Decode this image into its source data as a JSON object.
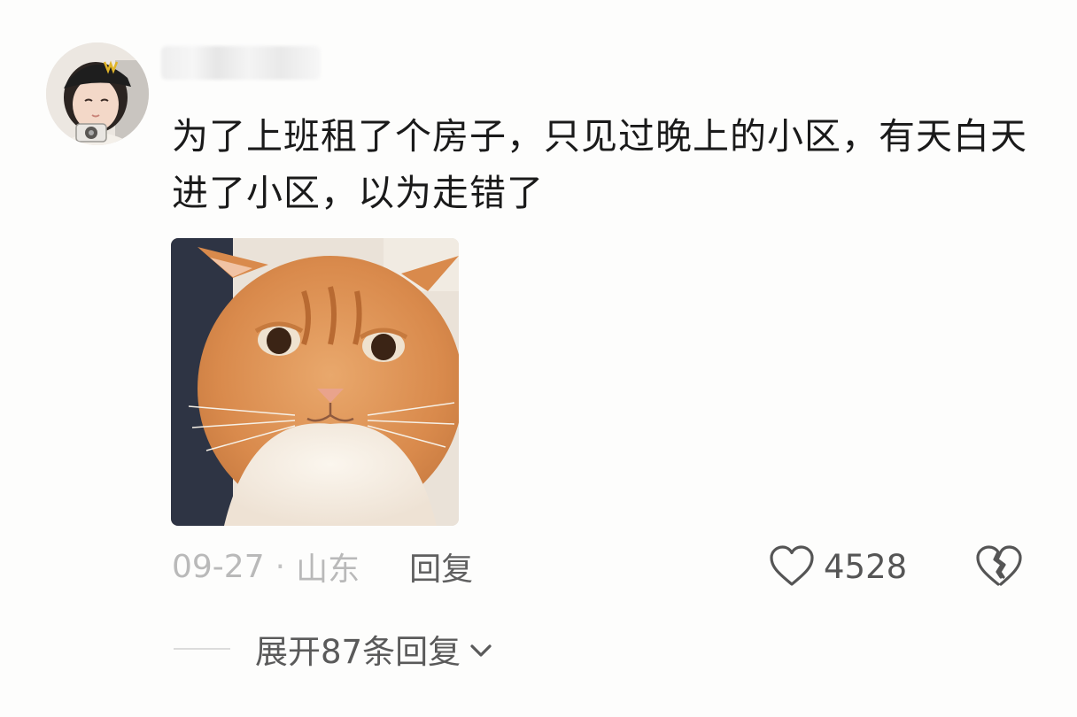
{
  "comment": {
    "text": "为了上班租了个房子，只见过晚上的小区，有天白天进了小区，以为走错了",
    "avatar_icon": "user-avatar",
    "attached_image": "orange-cat-photo",
    "date": "09-27",
    "separator": "·",
    "location": "山东",
    "reply_label": "回复",
    "like_icon": "heart-outline-icon",
    "like_count": "4528",
    "dislike_icon": "broken-heart-icon",
    "expand_label": "展开87条回复",
    "expand_icon": "chevron-down-icon"
  }
}
